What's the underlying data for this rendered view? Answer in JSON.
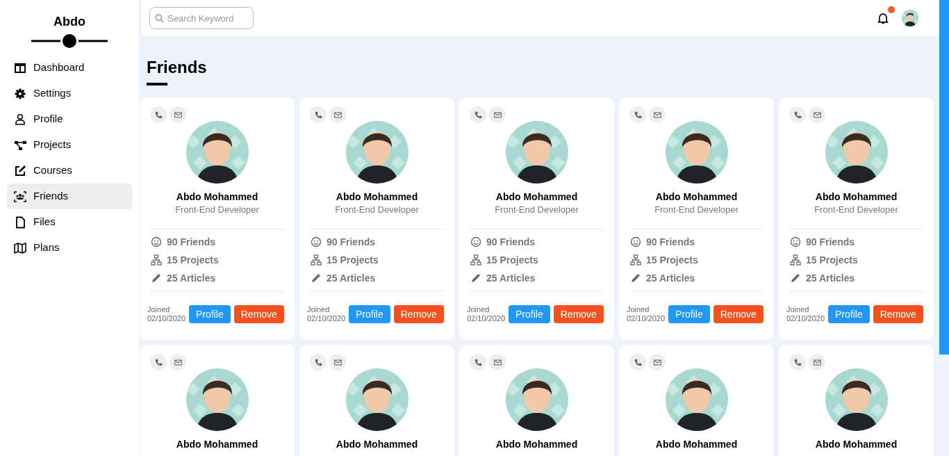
{
  "sidebar": {
    "brand": "Abdo",
    "items": [
      {
        "label": "Dashboard",
        "kind": "dashboard",
        "selected": false
      },
      {
        "label": "Settings",
        "kind": "settings",
        "selected": false
      },
      {
        "label": "Profile",
        "kind": "profile",
        "selected": false
      },
      {
        "label": "Projects",
        "kind": "projects",
        "selected": false
      },
      {
        "label": "Courses",
        "kind": "courses",
        "selected": false
      },
      {
        "label": "Friends",
        "kind": "friends",
        "selected": true
      },
      {
        "label": "Files",
        "kind": "files",
        "selected": false
      },
      {
        "label": "Plans",
        "kind": "plans",
        "selected": false
      }
    ]
  },
  "topbar": {
    "search": {
      "placeholder": "Search Keyword"
    },
    "notifications": {
      "unread": true
    }
  },
  "page_title": "Friends",
  "cards": [
    {
      "name": "Abdo Mohammed",
      "role": "Front-End Developer",
      "stats": [
        {
          "kind": "friends",
          "text": "90 Friends"
        },
        {
          "kind": "projects",
          "text": "15 Projects"
        },
        {
          "kind": "articles",
          "text": "25 Articles"
        }
      ],
      "joined_label": "Joined",
      "joined_date": "02/10/2020",
      "buttons": [
        {
          "kind": "primary",
          "label": "Profile"
        },
        {
          "kind": "danger",
          "label": "Remove"
        }
      ]
    },
    {
      "name": "Abdo Mohammed",
      "role": "Front-End Developer",
      "stats": [
        {
          "kind": "friends",
          "text": "90 Friends"
        },
        {
          "kind": "projects",
          "text": "15 Projects"
        },
        {
          "kind": "articles",
          "text": "25 Articles"
        }
      ],
      "joined_label": "Joined",
      "joined_date": "02/10/2020",
      "buttons": [
        {
          "kind": "primary",
          "label": "Profile"
        },
        {
          "kind": "danger",
          "label": "Remove"
        }
      ]
    },
    {
      "name": "Abdo Mohammed",
      "role": "Front-End Developer",
      "stats": [
        {
          "kind": "friends",
          "text": "90 Friends"
        },
        {
          "kind": "projects",
          "text": "15 Projects"
        },
        {
          "kind": "articles",
          "text": "25 Articles"
        }
      ],
      "joined_label": "Joined",
      "joined_date": "02/10/2020",
      "buttons": [
        {
          "kind": "primary",
          "label": "Profile"
        },
        {
          "kind": "danger",
          "label": "Remove"
        }
      ]
    },
    {
      "name": "Abdo Mohammed",
      "role": "Front-End Developer",
      "stats": [
        {
          "kind": "friends",
          "text": "90 Friends"
        },
        {
          "kind": "projects",
          "text": "15 Projects"
        },
        {
          "kind": "articles",
          "text": "25 Articles"
        }
      ],
      "joined_label": "Joined",
      "joined_date": "02/10/2020",
      "buttons": [
        {
          "kind": "primary",
          "label": "Profile"
        },
        {
          "kind": "danger",
          "label": "Remove"
        }
      ]
    },
    {
      "name": "Abdo Mohammed",
      "role": "Front-End Developer",
      "stats": [
        {
          "kind": "friends",
          "text": "90 Friends"
        },
        {
          "kind": "projects",
          "text": "15 Projects"
        },
        {
          "kind": "articles",
          "text": "25 Articles"
        }
      ],
      "joined_label": "Joined",
      "joined_date": "02/10/2020",
      "buttons": [
        {
          "kind": "primary",
          "label": "Profile"
        },
        {
          "kind": "danger",
          "label": "Remove"
        }
      ]
    },
    {
      "name": "Abdo Mohammed"
    },
    {
      "name": "Abdo Mohammed"
    },
    {
      "name": "Abdo Mohammed"
    },
    {
      "name": "Abdo Mohammed"
    },
    {
      "name": "Abdo Mohammed"
    }
  ]
}
